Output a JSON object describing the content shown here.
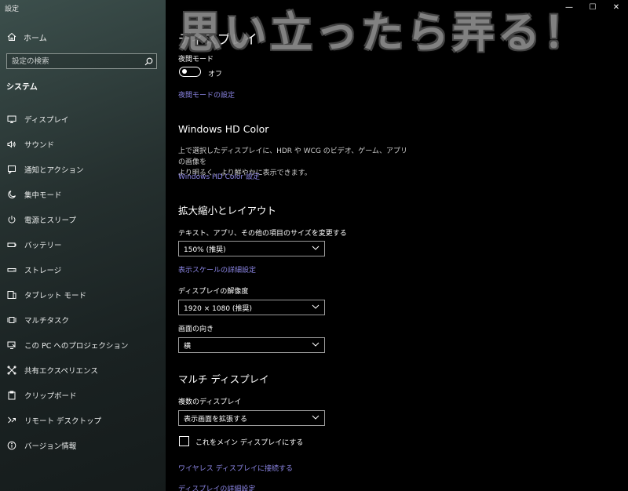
{
  "window": {
    "title": "設定",
    "controls": {
      "minimize": "—",
      "maximize": "☐",
      "close": "✕"
    }
  },
  "watermark": {
    "text": "思い立ったら弄る！"
  },
  "sidebar": {
    "home": "ホーム",
    "search_placeholder": "設定の検索",
    "section": "システム",
    "items": [
      {
        "label": "ディスプレイ",
        "icon": "monitor-icon"
      },
      {
        "label": "サウンド",
        "icon": "speaker-icon"
      },
      {
        "label": "通知とアクション",
        "icon": "notification-icon"
      },
      {
        "label": "集中モード",
        "icon": "moon-icon"
      },
      {
        "label": "電源とスリープ",
        "icon": "power-icon"
      },
      {
        "label": "バッテリー",
        "icon": "battery-icon"
      },
      {
        "label": "ストレージ",
        "icon": "storage-icon"
      },
      {
        "label": "タブレット モード",
        "icon": "tablet-icon"
      },
      {
        "label": "マルチタスク",
        "icon": "multitask-icon"
      },
      {
        "label": "この PC へのプロジェクション",
        "icon": "projection-icon"
      },
      {
        "label": "共有エクスペリエンス",
        "icon": "shared-icon"
      },
      {
        "label": "クリップボード",
        "icon": "clipboard-icon"
      },
      {
        "label": "リモート デスクトップ",
        "icon": "remote-icon"
      },
      {
        "label": "バージョン情報",
        "icon": "info-icon"
      }
    ]
  },
  "main": {
    "title": "ディスプレイ",
    "night_light": {
      "label": "夜間モード",
      "state": "オフ",
      "settings_link": "夜間モードの設定"
    },
    "hd_color": {
      "heading": "Windows HD Color",
      "description_line1": "上で選択したディスプレイに、HDR や WCG のビデオ、ゲーム、アプリの画像を",
      "description_line2": "より明るく、より鮮やかに表示できます。",
      "link": "Windows HD Color 設定"
    },
    "scale_layout": {
      "heading": "拡大縮小とレイアウト",
      "scale_label": "テキスト、アプリ、その他の項目のサイズを変更する",
      "scale_value": "150% (推奨)",
      "advanced_link": "表示スケールの詳細設定",
      "resolution_label": "ディスプレイの解像度",
      "resolution_value": "1920 × 1080 (推奨)",
      "orientation_label": "画面の向き",
      "orientation_value": "横"
    },
    "multi_display": {
      "heading": "マルチ ディスプレイ",
      "label": "複数のディスプレイ",
      "value": "表示画面を拡張する",
      "main_display_checkbox": "これをメイン ディスプレイにする",
      "wireless_link": "ワイヤレス ディスプレイに接続する",
      "advanced_link": "ディスプレイの詳細設定"
    }
  }
}
